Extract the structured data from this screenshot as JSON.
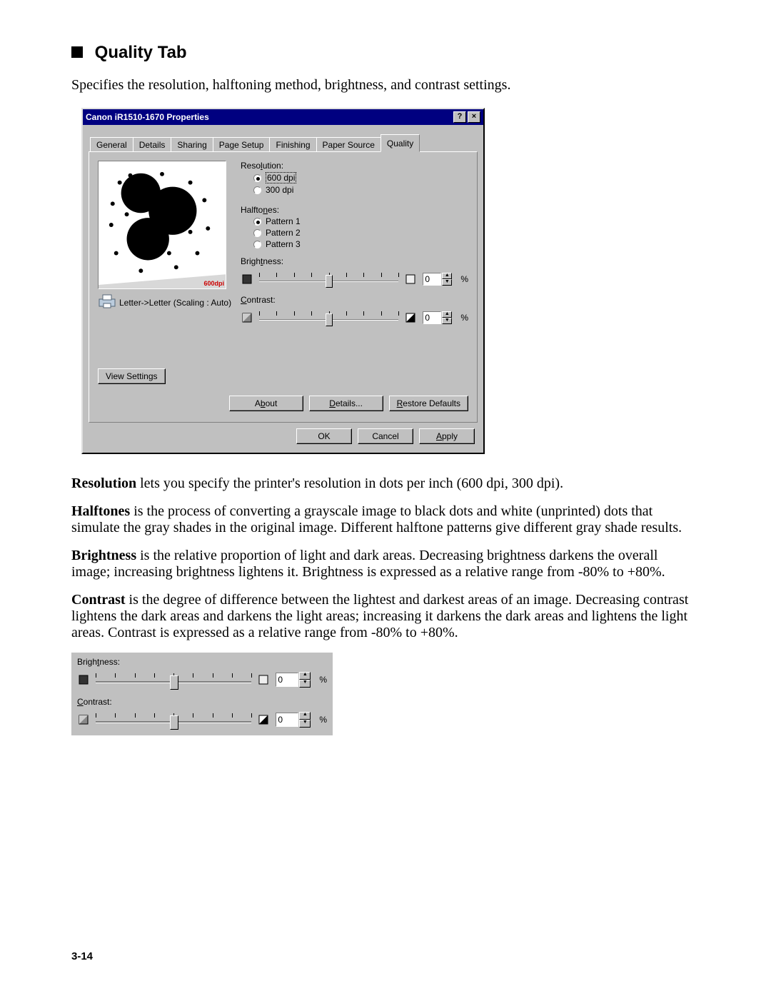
{
  "heading": "Quality Tab",
  "intro": "Specifies the resolution, halftoning method, brightness, and contrast settings.",
  "dialog": {
    "title": "Canon iR1510-1670 Properties",
    "help_symbol": "?",
    "close_symbol": "×",
    "tabs": [
      "General",
      "Details",
      "Sharing",
      "Page Setup",
      "Finishing",
      "Paper Source",
      "Quality"
    ],
    "active_tab_index": 6,
    "resolution": {
      "label": "Resolution:",
      "options": [
        "600 dpi",
        "300 dpi"
      ],
      "selected_index": 0,
      "label_underline": "l"
    },
    "halftones": {
      "label": "Halftones:",
      "options": [
        "Pattern 1",
        "Pattern 2",
        "Pattern 3"
      ],
      "selected_index": 0,
      "label_underline": "n"
    },
    "brightness": {
      "label": "Brightness:",
      "value": "0",
      "percent": "%",
      "label_underline": "t"
    },
    "contrast": {
      "label": "Contrast:",
      "value": "0",
      "percent": "%",
      "label_underline": "C"
    },
    "dpi_badge": "600dpi",
    "scaling_text": "Letter->Letter (Scaling : Auto)",
    "view_settings": "View Settings",
    "about": "About",
    "details": "Details...",
    "restore": "Restore Defaults",
    "ok": "OK",
    "cancel": "Cancel",
    "apply": "Apply"
  },
  "desc": {
    "resolution_b": "Resolution",
    "resolution_t": " lets you specify the printer's resolution in dots per inch (600 dpi, 300 dpi).",
    "halftones_b": "Halftones",
    "halftones_t": " is the process of converting a grayscale image to black dots and white (unprinted) dots that simulate the gray shades in the original image. Different halftone patterns give different gray shade results.",
    "brightness_b": "Brightness",
    "brightness_t": " is the relative proportion of light and dark areas. Decreasing brightness darkens the overall image; increasing brightness lightens it. Brightness is expressed as a relative range from -80% to +80%.",
    "contrast_b": "Contrast",
    "contrast_t": " is the degree of difference between the lightest and darkest areas of an image. Decreasing contrast lightens the dark areas and darkens the light areas; increasing it darkens the dark areas and lightens the light areas. Contrast is expressed as a relative range from -80% to +80%."
  },
  "page_number": "3-14"
}
